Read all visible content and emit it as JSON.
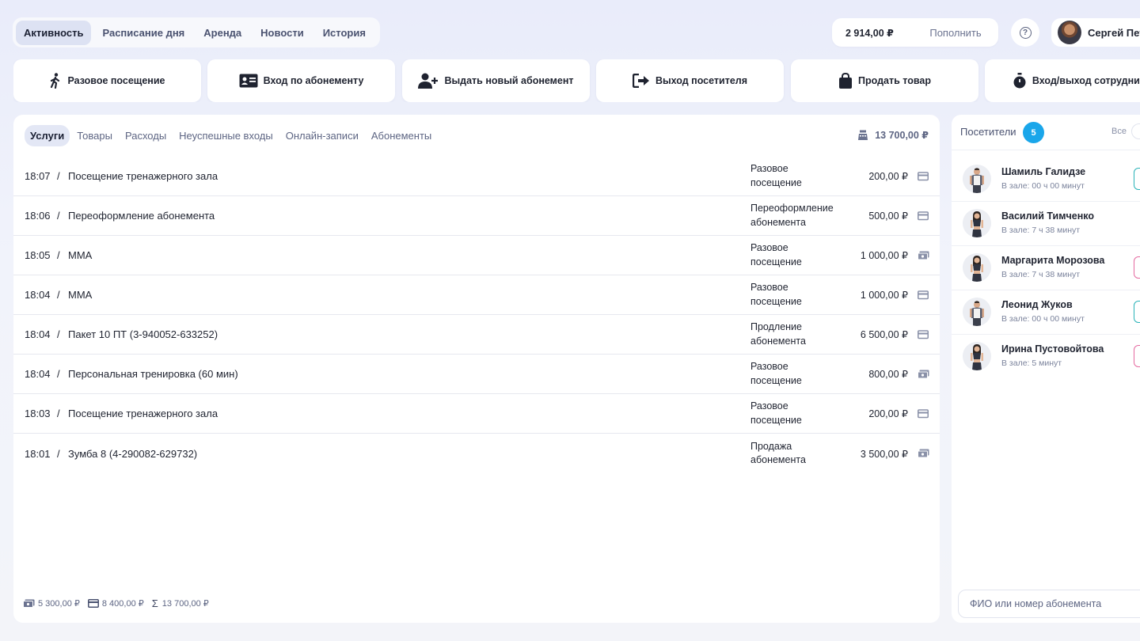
{
  "nav": {
    "tabs": [
      {
        "label": "Активность",
        "active": true
      },
      {
        "label": "Расписание дня",
        "active": false
      },
      {
        "label": "Аренда",
        "active": false
      },
      {
        "label": "Новости",
        "active": false
      },
      {
        "label": "История",
        "active": false
      }
    ]
  },
  "account": {
    "balance": "2 914,00 ₽",
    "topup_label": "Пополнить",
    "help_icon": "question-circle-icon",
    "user_name": "Сергей Пет"
  },
  "actions": [
    {
      "label": "Разовое посещение",
      "icon": "walking-person-icon"
    },
    {
      "label": "Вход по абонементу",
      "icon": "id-card-icon"
    },
    {
      "label": "Выдать новый абонемент",
      "icon": "user-plus-icon"
    },
    {
      "label": "Выход посетителя",
      "icon": "sign-out-icon"
    },
    {
      "label": "Продать товар",
      "icon": "shopping-bag-icon"
    },
    {
      "label": "Вход/выход сотрудник",
      "icon": "stopwatch-icon"
    }
  ],
  "main": {
    "tabs": [
      {
        "label": "Услуги",
        "active": true
      },
      {
        "label": "Товары",
        "active": false
      },
      {
        "label": "Расходы",
        "active": false
      },
      {
        "label": "Неуспешные входы",
        "active": false
      },
      {
        "label": "Онлайн-записи",
        "active": false
      },
      {
        "label": "Абонементы",
        "active": false
      }
    ],
    "total": "13 700,00 ₽",
    "rows": [
      {
        "time": "18:07",
        "name": "Посещение тренажерного зала",
        "type_line1": "Разовое",
        "type_line2": "посещение",
        "price": "200,00 ₽",
        "payment": "card"
      },
      {
        "time": "18:06",
        "name": "Переоформление абонемента",
        "type_line1": "Переоформление",
        "type_line2": "абонемента",
        "price": "500,00 ₽",
        "payment": "card"
      },
      {
        "time": "18:05",
        "name": "ММА",
        "type_line1": "Разовое",
        "type_line2": "посещение",
        "price": "1 000,00 ₽",
        "payment": "cash"
      },
      {
        "time": "18:04",
        "name": "ММА",
        "type_line1": "Разовое",
        "type_line2": "посещение",
        "price": "1 000,00 ₽",
        "payment": "card"
      },
      {
        "time": "18:04",
        "name": "Пакет 10 ПТ (3-940052-633252)",
        "type_line1": "Продление",
        "type_line2": "абонемента",
        "price": "6 500,00 ₽",
        "payment": "card"
      },
      {
        "time": "18:04",
        "name": "Персональная тренировка (60 мин)",
        "type_line1": "Разовое",
        "type_line2": "посещение",
        "price": "800,00 ₽",
        "payment": "cash"
      },
      {
        "time": "18:03",
        "name": "Посещение тренажерного зала",
        "type_line1": "Разовое",
        "type_line2": "посещение",
        "price": "200,00 ₽",
        "payment": "card"
      },
      {
        "time": "18:01",
        "name": "Зумба 8 (4-290082-629732)",
        "type_line1": "Продажа",
        "type_line2": "абонемента",
        "price": "3 500,00 ₽",
        "payment": "cash"
      }
    ],
    "summary": {
      "cash": "5 300,00 ₽",
      "card": "8 400,00 ₽",
      "sum": "13 700,00 ₽"
    }
  },
  "visitors": {
    "title": "Посетители",
    "count": "5",
    "filter_label": "Все",
    "list": [
      {
        "name": "Шамиль Галидзе",
        "time": "В зале: 00 ч 00 минут",
        "gender": "male",
        "tag_color": "#2bb3b8"
      },
      {
        "name": "Василий Тимченко",
        "time": "В зале: 7 ч 38 минут",
        "gender": "female",
        "tag_color": ""
      },
      {
        "name": "Маргарита Морозова",
        "time": "В зале: 7 ч 38 минут",
        "gender": "female",
        "tag_color": "#e56ba1"
      },
      {
        "name": "Леонид Жуков",
        "time": "В зале: 00 ч 00 минут",
        "gender": "male",
        "tag_color": "#2bb3b8"
      },
      {
        "name": "Ирина Пустовойтова",
        "time": "В зале: 5 минут",
        "gender": "female",
        "tag_color": "#e56ba1"
      }
    ],
    "search_placeholder": "ФИО или номер абонемента"
  }
}
